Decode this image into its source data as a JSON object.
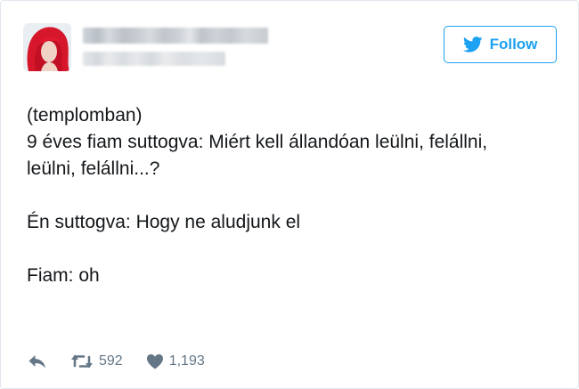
{
  "tweet": {
    "follow_label": "Follow",
    "lines": [
      "(templomban)",
      "9 éves fiam suttogva: Miért kell állandóan leülni, felállni,",
      "leülni, felállni...?",
      "",
      "Én suttogva: Hogy ne aludjunk el",
      "",
      "Fiam: oh"
    ],
    "retweet_count": "592",
    "like_count": "1,193"
  },
  "icons": {
    "follow": "twitter-bird-icon",
    "reply": "reply-arrow-icon",
    "retweet": "retweet-icon",
    "like": "heart-icon"
  },
  "colors": {
    "accent": "#1da1f2",
    "text": "#14171a",
    "muted": "#657786",
    "border": "#e1e8ed"
  }
}
